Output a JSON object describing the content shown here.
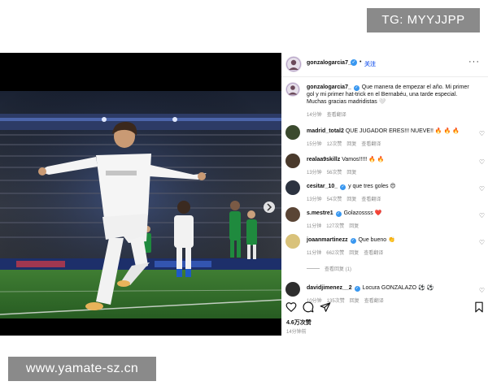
{
  "watermarks": {
    "top": "TG: MYYJJPP",
    "bottom": "www.yamate-sz.cn"
  },
  "post": {
    "username": "gonzalogarcia7_",
    "dot": "•",
    "follow_label": "关注",
    "more_icon": "more-horizontal-icon"
  },
  "caption": {
    "username": "gonzalogarcia7_",
    "text": "Que manera de empezar el año. Mi primer gol y mi primer hat-trick en el Bernabéu, una tarde especial. Muchas gracias madridistas 🤍",
    "time": "14分钟",
    "translate": "查看翻译"
  },
  "comments": [
    {
      "username": "madrid_total2",
      "verified": false,
      "text": "QUE JUGADOR ERES!!! NUEVE!! 🔥 🔥 🔥",
      "time": "15分钟",
      "likes": "12次赞",
      "reply": "回复",
      "translate": "查看翻译",
      "avatar_color": "#3b4a2e"
    },
    {
      "username": "realaa9skillz",
      "verified": false,
      "text": "Vamos!!!!! 🔥 🔥",
      "time": "13分钟",
      "likes": "56次赞",
      "reply": "回复",
      "translate": "",
      "avatar_color": "#4a3a2c"
    },
    {
      "username": "cesitar_10_",
      "verified": true,
      "text": "y que tres goles 😍",
      "time": "13分钟",
      "likes": "54次赞",
      "reply": "回复",
      "translate": "查看翻译",
      "avatar_color": "#2c3340"
    },
    {
      "username": "s.mestre1",
      "verified": true,
      "text": "Golazossss ❤️",
      "time": "11分钟",
      "likes": "127次赞",
      "reply": "回复",
      "translate": "",
      "avatar_color": "#5a4535"
    },
    {
      "username": "joaanmartinezz",
      "verified": true,
      "text": "Que bueno 👏",
      "time": "11分钟",
      "likes": "662次赞",
      "reply": "回复",
      "translate": "查看翻译",
      "avatar_color": "#d9c27a"
    },
    {
      "username": "davidjimenez__2",
      "verified": true,
      "text": "Locura GONZALAZO ⚽ ⚽",
      "time": "10分钟",
      "likes": "135次赞",
      "reply": "回复",
      "translate": "查看翻译",
      "avatar_color": "#2e2e2e"
    }
  ],
  "replies_label": "查看回复 (1)",
  "actions": {
    "icons": [
      "heart-icon",
      "comment-icon",
      "share-icon",
      "bookmark-icon"
    ]
  },
  "likes_count": "4.6万次赞",
  "post_date": "14分钟前",
  "colors": {
    "verified": "#3897f0",
    "follow": "#3a6df0",
    "pitch": "#2f6b2a",
    "kit_white": "#f2f2f2",
    "kit_green": "#1f8a3e"
  }
}
